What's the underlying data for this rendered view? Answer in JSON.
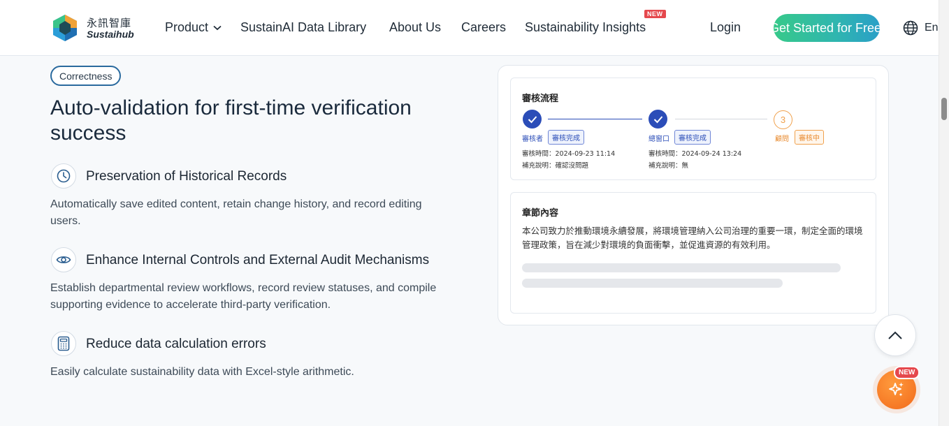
{
  "header": {
    "logo_cn": "永訊智庫",
    "logo_en": "Sustaihub",
    "nav": [
      {
        "label": "Product"
      },
      {
        "label": "SustainAI Data Library"
      },
      {
        "label": "About Us"
      },
      {
        "label": "Careers"
      },
      {
        "label": "Sustainability Insights",
        "badge": "NEW"
      }
    ],
    "login": "Login",
    "cta": "Get Started for Free",
    "lang": "En"
  },
  "section": {
    "tag": "Correctness",
    "headline": "Auto-validation for first-time verification success",
    "features": [
      {
        "icon": "clock-icon",
        "title": "Preservation of Historical Records",
        "desc": "Automatically save edited content, retain change history, and record editing users."
      },
      {
        "icon": "eye-icon",
        "title": "Enhance Internal Controls and External Audit Mechanisms",
        "desc": "Establish departmental review workflows, record review statuses, and compile supporting evidence to accelerate third-party verification."
      },
      {
        "icon": "calculator-icon",
        "title": "Reduce data calculation errors",
        "desc": "Easily calculate sustainability data with Excel-style arithmetic."
      }
    ]
  },
  "review": {
    "title": "審核流程",
    "steps": [
      {
        "role": "審核者",
        "status": "審核完成",
        "time": "審核時間：2024-09-23 11:14",
        "note": "補充說明：確認沒問題"
      },
      {
        "role": "總窗口",
        "status": "審核完成",
        "time": "審核時間：2024-09-24 13:24",
        "note": "補充說明：無"
      },
      {
        "number": "3",
        "role": "顧問",
        "status": "審核中"
      }
    ]
  },
  "chapter": {
    "title": "章節內容",
    "text": "本公司致力於推動環境永續發展，將環境管理納入公司治理的重要一環，制定全面的環境管理政策，旨在減少對環境的負面衝擊，並促進資源的有效利用。"
  },
  "float": {
    "new_badge": "NEW"
  },
  "colors": {
    "primary_blue": "#2b4db8",
    "pending_orange": "#f0a04b",
    "cta_green": "#37c98a",
    "ai_orange": "#f26a1b"
  }
}
